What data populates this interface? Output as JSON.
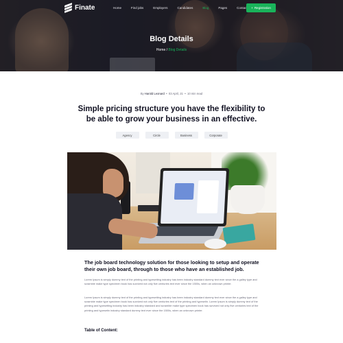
{
  "brand": {
    "name": "Finate"
  },
  "nav": {
    "items": [
      "Home",
      "Find jobs",
      "Employers",
      "Candidates",
      "Blog",
      "Pages",
      "Contact"
    ],
    "active_index": 4,
    "cta_label": "Registration"
  },
  "hero": {
    "title": "Blog Details",
    "breadcrumb": {
      "home": "Home",
      "separator": "/",
      "current": "Blog Details"
    }
  },
  "post": {
    "meta": {
      "by": "By",
      "author": "Harold Leonard",
      "date": "03 April, 21",
      "read_time": "10 min read"
    },
    "title": "Simple pricing structure you have the flexibility to be able to grow your business in an effective.",
    "tags": [
      "Agency",
      "Circle",
      "Business",
      "Corporate"
    ],
    "subheading": "The job board technology solution for those looking to setup and operate their own job board, through to those who have an established job.",
    "paragraphs": [
      "Lorem Ipsum is simply dummy text of the printing and typesetting industry has been industry standard dummy text ever since the a galley type and scramble make type specimen book has survived not only five centuries text ever since the 1500s, when an unknown printer.",
      "Lorem Ipsum is simply dummy text of the printing and typesetting industry has been industry standard dummy text ever since the a galley type and scramble make type specimen book has survived not only five centuries text of the printing and typesetin. Lorem Ipsum is simply dummy text of the printing and typesetting industry has been industry standard and scramble make type specimen book has survived not only five centuries text of the printing and typesetin industry standard dummy text ever since the 1500s, when an unknown printer."
    ],
    "toc_heading": "Table of Content:"
  },
  "colors": {
    "accent": "#19b35a",
    "hero_overlay": "#14141e",
    "tag_bg": "#eef0f4"
  }
}
